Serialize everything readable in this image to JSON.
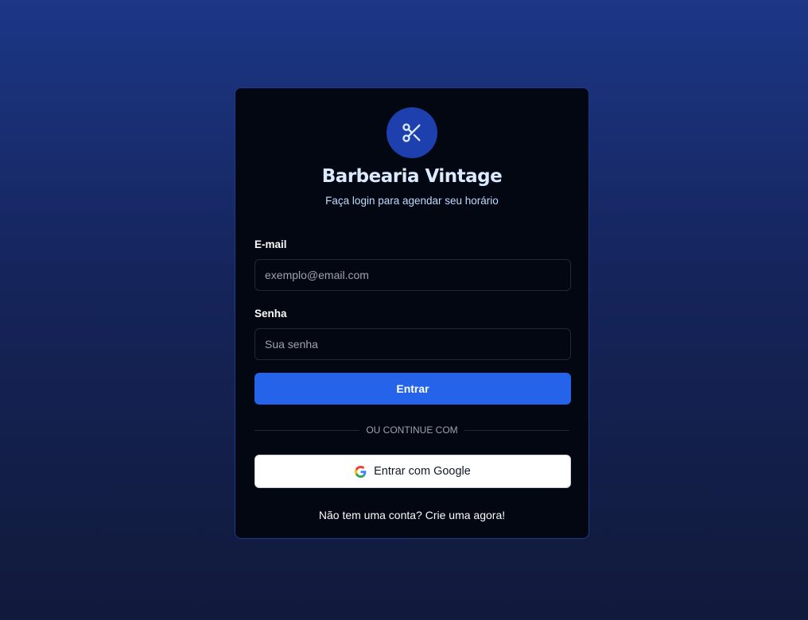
{
  "brand": {
    "title": "Barbearia Vintage",
    "subtitle": "Faça login para agendar seu horário",
    "icon": "scissors-icon",
    "accent": "#2563eb"
  },
  "form": {
    "email": {
      "label": "E-mail",
      "placeholder": "exemplo@email.com",
      "value": ""
    },
    "password": {
      "label": "Senha",
      "placeholder": "Sua senha",
      "value": ""
    },
    "submit_label": "Entrar"
  },
  "divider": "OU CONTINUE COM",
  "google": {
    "label": "Entrar com Google",
    "icon": "google-icon"
  },
  "footer": {
    "text": "Não tem uma conta?",
    "link": "Crie uma agora!"
  }
}
